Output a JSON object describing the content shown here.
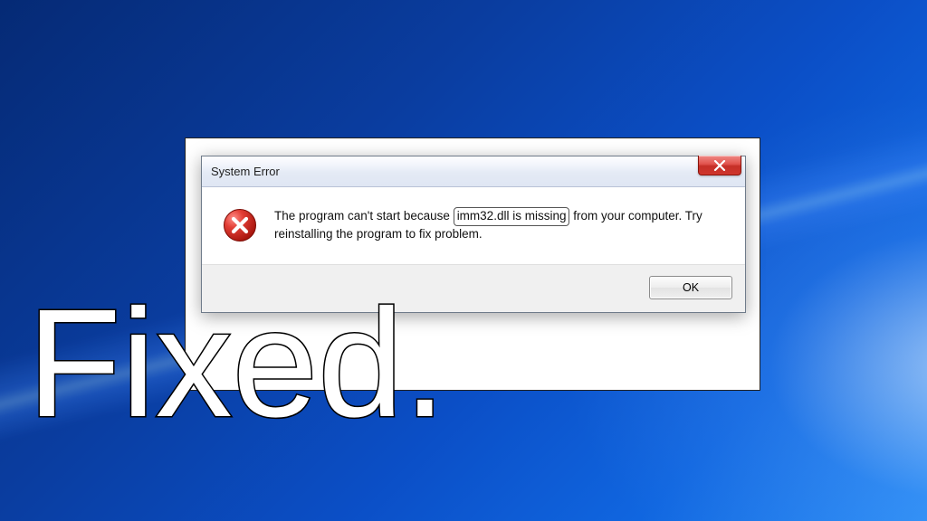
{
  "dialog": {
    "title": "System Error",
    "message_pre": "The program can't start because ",
    "message_highlight": "imm32.dll is missing",
    "message_post": " from your computer. Try reinstalling the program to fix problem.",
    "ok_label": "OK"
  },
  "overlay": {
    "text": "Fixed."
  }
}
